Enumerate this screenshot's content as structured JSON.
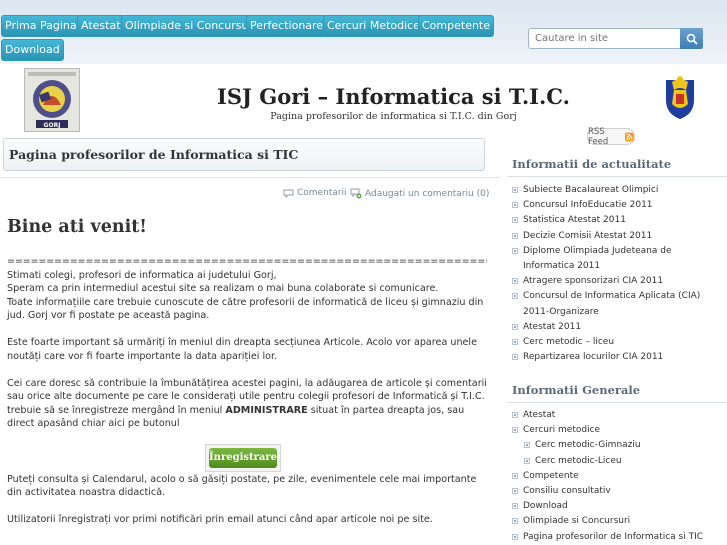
{
  "nav": {
    "items": [
      "Prima Pagina",
      "Atestat",
      "Olimpiade si Concursuri",
      "Perfectionare",
      "Cercuri Metodice",
      "Competente",
      "Download"
    ]
  },
  "search": {
    "placeholder": "Cautare in site"
  },
  "header": {
    "title": "ISJ Gori – Informatica si T.I.C.",
    "subtitle": "Pagina profesorilor de informatica si T.I.C. din Gorj",
    "logo_caption": "GORJ"
  },
  "page": {
    "title": "Pagina profesorilor de Informatica si TIC"
  },
  "meta": {
    "comments": "Comentarii",
    "add_comment": "Adaugati un comentariu (0)"
  },
  "post": {
    "heading": "Bine ati venit!",
    "separator": "=====================================================================================",
    "p1": "Stimati colegi, profesori de informatica ai judetului Gorj,\nSperam ca prin intermediul acestui site sa realizam o mai buna colaborate si comunicare.\nToate informațiile care trebuie cunoscute de către profesorii de informatică de liceu și gimnaziu din jud. Gorj vor fi postate pe această pagina.",
    "p2": "Este foarte important să urmăriți în meniul din dreapta secțiunea Articole. Acolo vor aparea unele noutăți care vor fi foarte importante la data apariției lor.",
    "p3_a": "Cei care doresc să contribuie la îmbunătățirea acestei pagini, la adăugarea de articole și comentarii sau orice alte documente pe care le considerați utile pentru colegii profesori de Informatică și T.I.C. trebuie să se înregistreze mergând în meniul ",
    "p3_strong": "ADMINISTRARE",
    "p3_b": "  situat în partea dreapta jos, sau direct apasând chiar aici  pe butonul",
    "register_button": "Înregistrare",
    "p4": "Puteți consulta și Calendarul, acolo o să găsiți postate, pe zile, evenimentele cele mai importante din activitatea noastra didactică.",
    "p5": "Utilizatorii înregistrați vor primi notificări prin email atunci când apar articole noi pe site."
  },
  "rss": {
    "label": "RSS Feed"
  },
  "sidebar": {
    "news_title": "Informatii de actualitate",
    "news_items": [
      "Subiecte Bacalaureat Olimpici",
      "Concursul InfoEducatie 2011",
      "Statistica Atestat 2011",
      "Decizie Comisii Atestat 2011",
      "Diplome Olimpiada Judeteana de Informatica 2011",
      "Atragere sponsorizari CIA 2011",
      "Concursul de Informatica Aplicata (CIA) 2011-Organizare",
      "Atestat 2011",
      "Cerc metodic – liceu",
      "Repartizarea locurilor CIA 2011"
    ],
    "general_title": "Informatii Generale",
    "general_items": [
      {
        "label": "Atestat",
        "sub": false
      },
      {
        "label": "Cercuri metodice",
        "sub": false
      },
      {
        "label": "Cerc metodic-Gimnaziu",
        "sub": true
      },
      {
        "label": "Cerc metodic-Liceu",
        "sub": true
      },
      {
        "label": "Competente",
        "sub": false
      },
      {
        "label": "Consiliu consultativ",
        "sub": false
      },
      {
        "label": "Download",
        "sub": false
      },
      {
        "label": "Olimpiade si Concursuri",
        "sub": false
      },
      {
        "label": "Pagina profesorilor de Informatica si TIC",
        "sub": false
      }
    ]
  },
  "colors": {
    "nav_button": "#2a93b3",
    "register_button": "#5f9a2a",
    "sidebar_heading": "#5a6a7a"
  }
}
